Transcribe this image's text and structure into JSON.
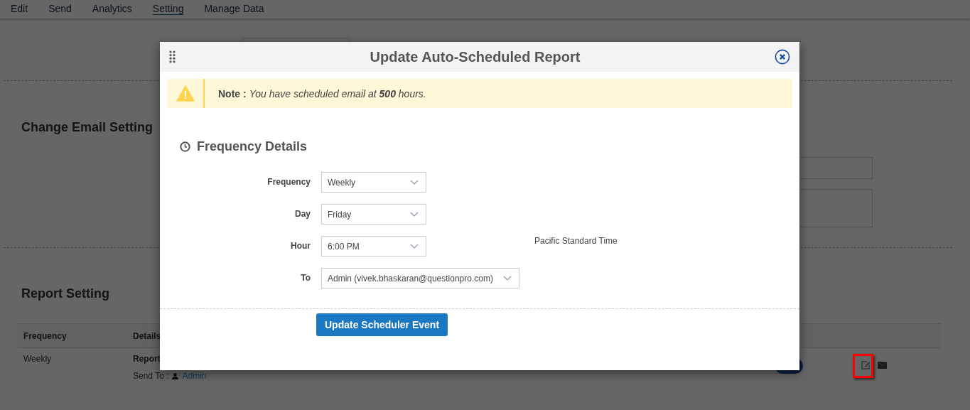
{
  "nav": [
    {
      "label": "Edit",
      "selected": false
    },
    {
      "label": "Send",
      "selected": false
    },
    {
      "label": "Analytics",
      "selected": false
    },
    {
      "label": "Setting",
      "selected": true
    },
    {
      "label": "Manage Data",
      "selected": false
    }
  ],
  "email_setting": {
    "title": "Change Email Setting"
  },
  "report_setting": {
    "title": "Report Setting",
    "columns": [
      "Frequency",
      "Details"
    ],
    "rows": [
      {
        "frequency": "Weekly",
        "report": "Report",
        "send_to_label": "Send To :",
        "send_to": "Admin",
        "enabled": true
      }
    ]
  },
  "dialog": {
    "title": "Update Auto-Scheduled Report",
    "note": {
      "label": "Note :",
      "text": "You have scheduled email at **500** hours."
    },
    "section_title": "Frequency Details",
    "fields": [
      {
        "label": "Frequency",
        "value": "Weekly"
      },
      {
        "label": "Day",
        "value": "Friday"
      },
      {
        "label": "Hour",
        "value": "6:00 PM"
      },
      {
        "label": "To",
        "value": "Admin (vivek.bhaskaran@questionpro.com)"
      }
    ],
    "timezone": "Pacific Standard Time",
    "button": "Update Scheduler Event"
  }
}
